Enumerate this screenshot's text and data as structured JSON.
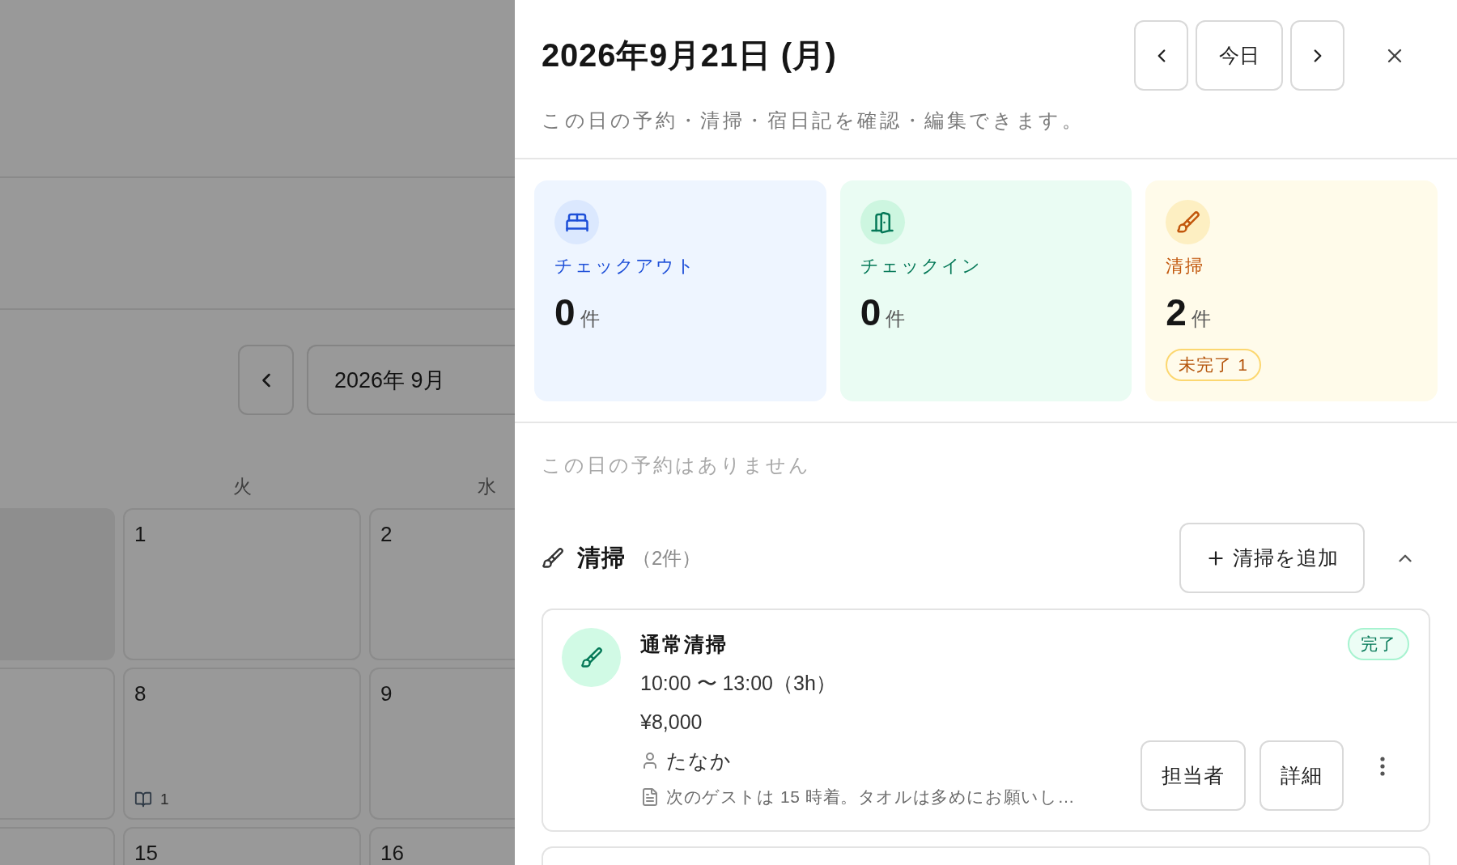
{
  "background_calendar": {
    "month_label": "2026年 9月",
    "weekdays": [
      "火",
      "水"
    ],
    "weeks": [
      {
        "cells": [
          {
            "kind": "blank"
          },
          {
            "kind": "day",
            "day": "1"
          },
          {
            "kind": "day",
            "day": "2"
          }
        ]
      },
      {
        "cells": [
          {
            "kind": "day"
          },
          {
            "kind": "day",
            "day": "8",
            "diary_count": "1"
          },
          {
            "kind": "day",
            "day": "9"
          }
        ]
      },
      {
        "cells": [
          {
            "kind": "day"
          },
          {
            "kind": "day",
            "day": "15"
          },
          {
            "kind": "day",
            "day": "16"
          }
        ]
      }
    ]
  },
  "panel": {
    "title": "2026年9月21日 (月)",
    "today_button": "今日",
    "subtitle": "この日の予約・清掃・宿日記を確認・編集できます。",
    "stats": [
      {
        "kind": "checkout",
        "label": "チェックアウト",
        "count": "0",
        "unit": "件"
      },
      {
        "kind": "checkin",
        "label": "チェックイン",
        "count": "0",
        "unit": "件"
      },
      {
        "kind": "cleaning",
        "label": "清掃",
        "count": "2",
        "unit": "件",
        "badge": "未完了 1"
      }
    ],
    "empty_reservations": "この日の予約はありません",
    "cleaning_section": {
      "title": "清掃",
      "count": "（2件）",
      "add_button": "清掃を追加",
      "expanded": true,
      "items": [
        {
          "kind": "full",
          "title": "通常清掃",
          "time": "10:00 〜 13:00（3h）",
          "price": "¥8,000",
          "assignee": "たなか",
          "note": "次のゲストは 15 時着。タオルは多めにお願いし…",
          "status": "完了",
          "completed": true,
          "buttons": [
            "担当者",
            "詳細"
          ]
        },
        {
          "kind": "cut_off"
        }
      ]
    }
  }
}
